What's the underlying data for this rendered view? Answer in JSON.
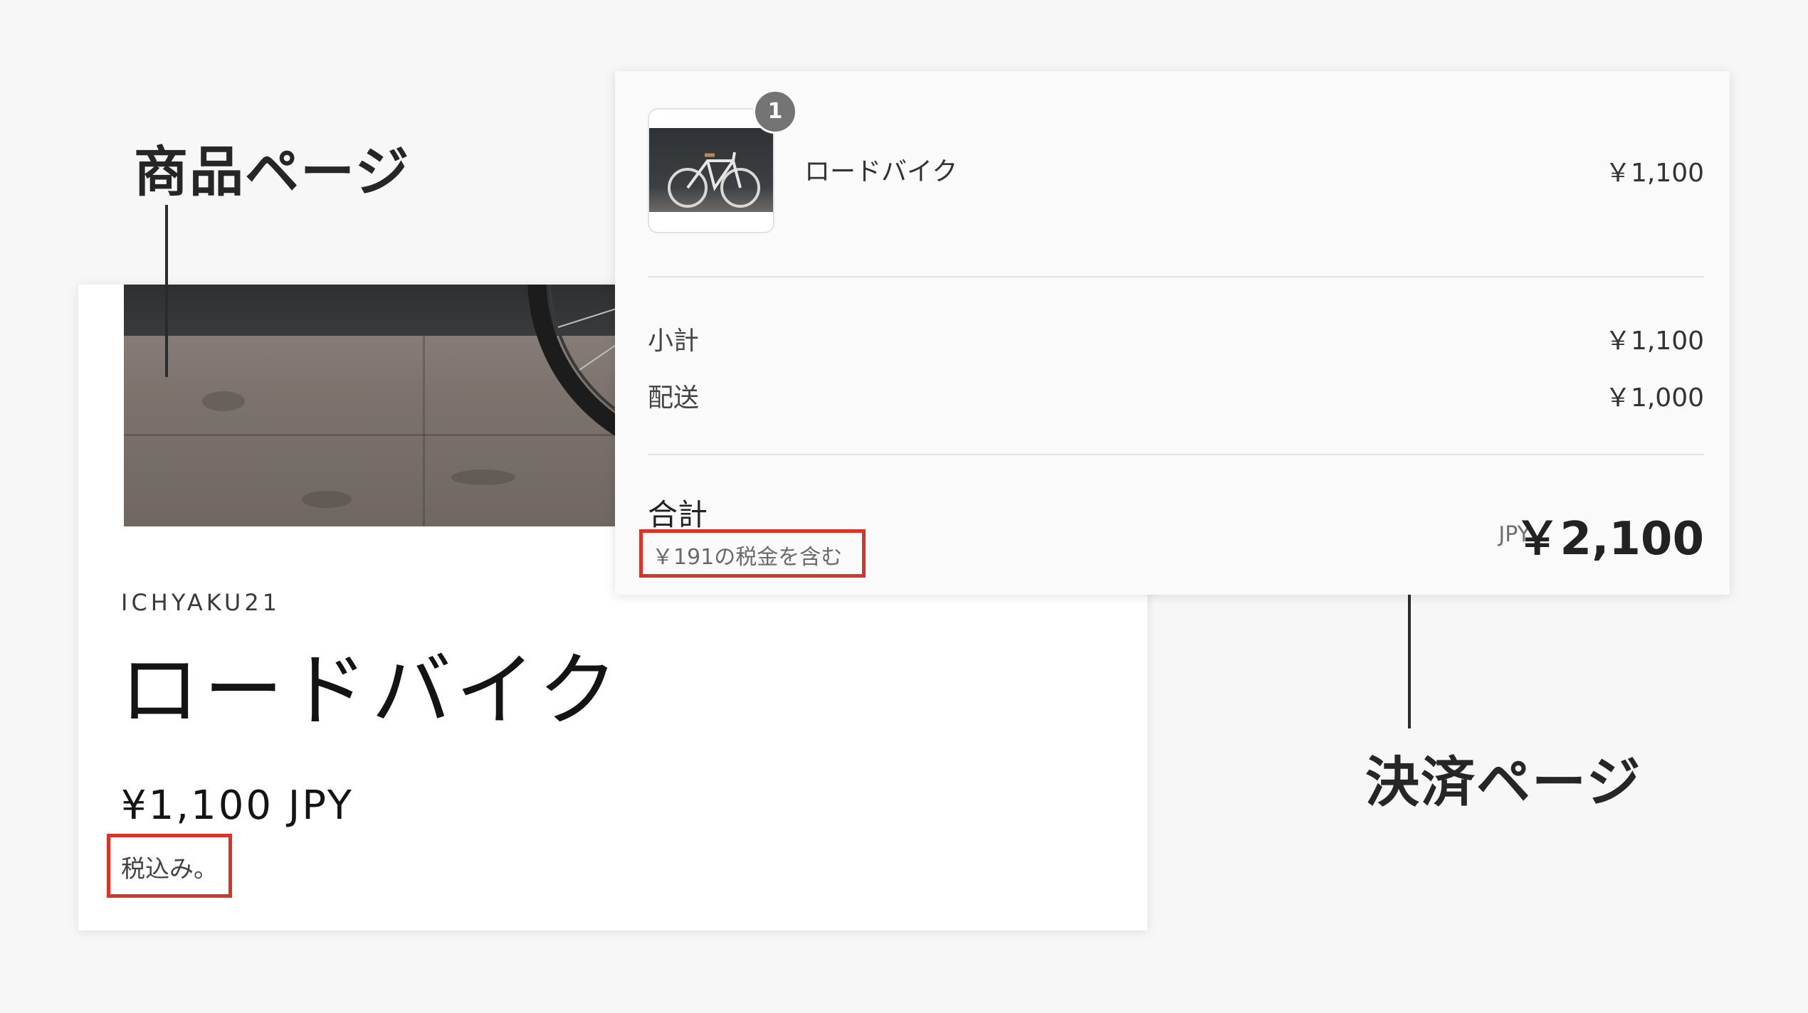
{
  "callouts": {
    "product_page": "商品ページ",
    "checkout_page": "決済ページ"
  },
  "product": {
    "brand": "ICHYAKU21",
    "title": "ロードバイク",
    "price": "¥1,100 JPY",
    "tax_note": "税込み。"
  },
  "checkout": {
    "item": {
      "quantity": "1",
      "name": "ロードバイク",
      "price": "￥1,100"
    },
    "subtotal": {
      "label": "小計",
      "value": "￥1,100"
    },
    "shipping": {
      "label": "配送",
      "value": "￥1,000"
    },
    "total": {
      "label": "合計",
      "tax_note": "￥191の税金を含む",
      "currency": "JPY",
      "amount": "￥2,100"
    }
  },
  "colors": {
    "highlight_box": "#d6352a",
    "background": "#f7f7f7",
    "badge": "#747474"
  }
}
